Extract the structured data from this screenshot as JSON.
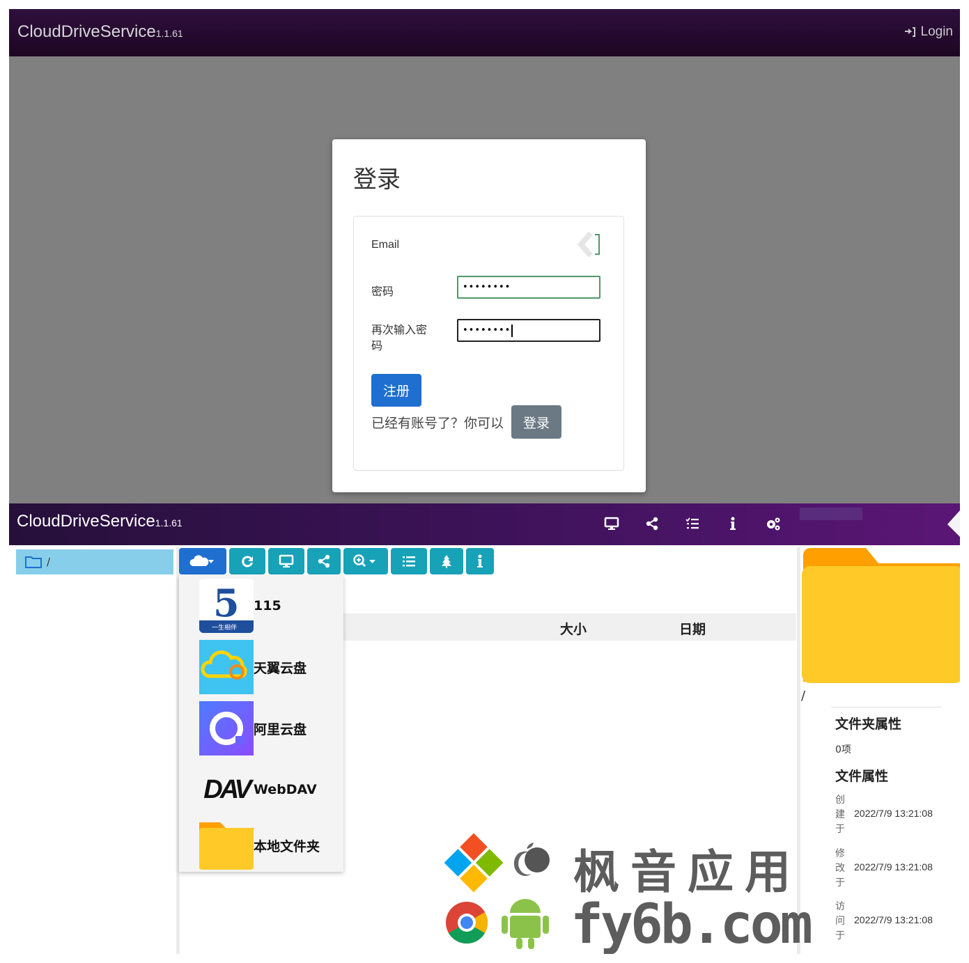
{
  "top": {
    "brand": "CloudDriveService",
    "version": "1.1.61",
    "login_link": "Login",
    "modal": {
      "title": "登录",
      "email_label": "Email",
      "password_label": "密码",
      "password_value": "••••••••",
      "confirm_label_line1": "再次输入密",
      "confirm_label_line2": "码",
      "confirm_value": "••••••••",
      "register_button": "注册",
      "already_text": "已经有账号了？你可以",
      "login_button": "登录"
    }
  },
  "bottom": {
    "brand": "CloudDriveService",
    "version": "1.1.61",
    "nav_icons": [
      "monitor-icon",
      "share-icon",
      "tasks-icon",
      "info-icon",
      "settings-icon"
    ],
    "breadcrumb": "/",
    "toolbar": [
      "cloud-add-icon",
      "refresh-icon",
      "monitor-icon",
      "share-icon",
      "zoom-icon",
      "list-icon",
      "tree-icon",
      "info-icon"
    ],
    "table_headers": {
      "size": "大小",
      "date": "日期"
    },
    "dropdown": [
      {
        "label": "115",
        "icon": "115-logo-icon",
        "sub": "一生相伴"
      },
      {
        "label": "天翼云盘",
        "icon": "tianyi-cloud-icon"
      },
      {
        "label": "阿里云盘",
        "icon": "aliyun-drive-icon"
      },
      {
        "label": "WebDAV",
        "icon": "webdav-logo-icon",
        "logo_text": "DAV"
      },
      {
        "label": "本地文件夹",
        "icon": "local-folder-icon"
      }
    ],
    "path": "/",
    "folder_props_title": "文件夹属性",
    "item_count": "0项",
    "file_props_title": "文件属性",
    "props": [
      {
        "k": "创建于",
        "v": "2022/7/9 13:21:08"
      },
      {
        "k": "修改于",
        "v": "2022/7/9 13:21:08"
      },
      {
        "k": "访问于",
        "v": "2022/7/9 13:21:08"
      }
    ],
    "watermark": {
      "cn": "枫音应用",
      "en": "fy6b.com"
    }
  },
  "colors": {
    "accent": "#1e6fd0",
    "toolbar": "#17a2b8",
    "nav_dark": "#2f0f3e",
    "crumb": "#87ceeb",
    "folder": "#ffca28"
  }
}
